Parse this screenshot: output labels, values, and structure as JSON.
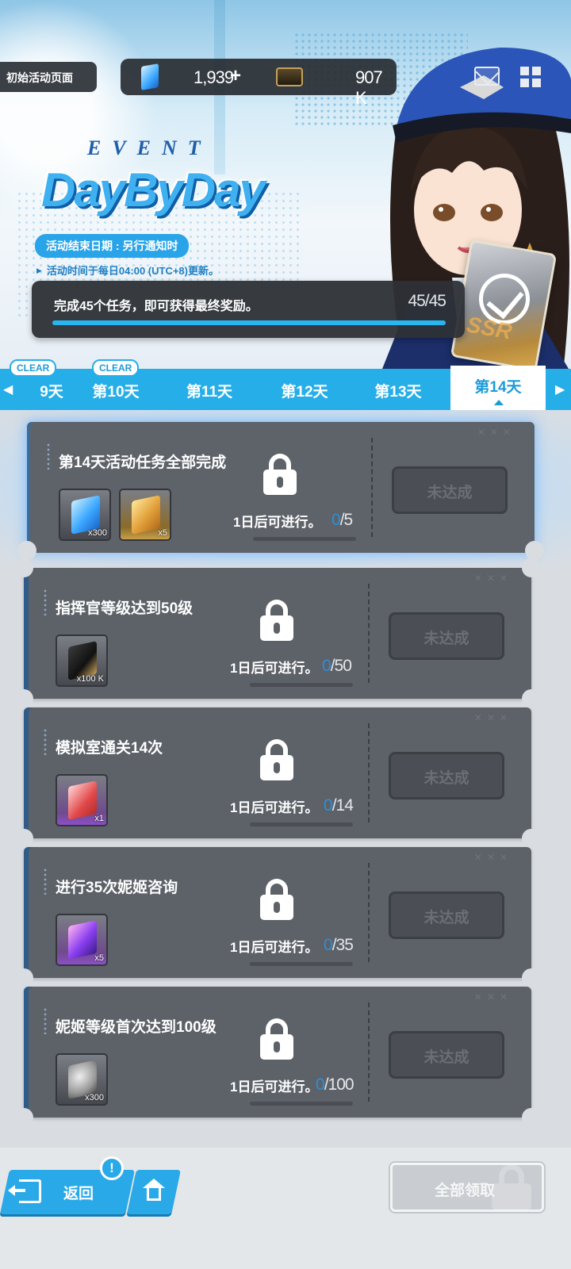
{
  "header": {
    "page_label": "初始活动页面",
    "gems": "1,939",
    "plus": "+",
    "credits": "907 K"
  },
  "event": {
    "event_word": "EVENT",
    "title": "DayByDay",
    "end_date": "活动结束日期 : 另行通知时",
    "refresh_note": "活动时间于每日04:00 (UTC+8)更新。",
    "stamp_label": "SSR"
  },
  "progress": {
    "text": "完成45个任务，即可获得最终奖励。",
    "count": "45/45",
    "fraction": 1.0
  },
  "tabs": {
    "left_arrow": "◀",
    "right_arrow": "▶",
    "items": [
      {
        "label": "9天",
        "badge": "CLEAR"
      },
      {
        "label": "第10天",
        "badge": "CLEAR"
      },
      {
        "label": "第11天",
        "badge": ""
      },
      {
        "label": "第12天",
        "badge": ""
      },
      {
        "label": "第13天",
        "badge": ""
      },
      {
        "label": "第14天",
        "badge": "",
        "active": true
      }
    ]
  },
  "missions": [
    {
      "title": "第14天活动任务全部完成",
      "unlock": "1日后可进行。",
      "current": "0",
      "total": "/5",
      "button": "未达成",
      "rewards": [
        {
          "icon": "gem-icon",
          "qty": "x300"
        },
        {
          "icon": "gold-ticket-icon",
          "qty": "x5"
        }
      ]
    },
    {
      "title": "指挥官等级达到50级",
      "unlock": "1日后可进行。",
      "current": "0",
      "total": "/50",
      "button": "未达成",
      "rewards": [
        {
          "icon": "credit-icon",
          "qty": "x100 K"
        }
      ]
    },
    {
      "title": "模拟室通关14次",
      "unlock": "1日后可进行。",
      "current": "0",
      "total": "/14",
      "button": "未达成",
      "rewards": [
        {
          "icon": "ticket-icon",
          "qty": "x1"
        }
      ]
    },
    {
      "title": "进行35次妮姬咨询",
      "unlock": "1日后可进行。",
      "current": "0",
      "total": "/35",
      "button": "未达成",
      "rewards": [
        {
          "icon": "purple-gem-icon",
          "qty": "x5"
        }
      ]
    },
    {
      "title": "妮姬等级首次达到100级",
      "unlock": "1日后可进行。",
      "current": "0",
      "total": "/100",
      "button": "未达成",
      "rewards": [
        {
          "icon": "core-ball-icon",
          "qty": "x300"
        }
      ]
    }
  ],
  "footer": {
    "back": "返回",
    "alert": "!",
    "claim_all": "全部领取"
  }
}
